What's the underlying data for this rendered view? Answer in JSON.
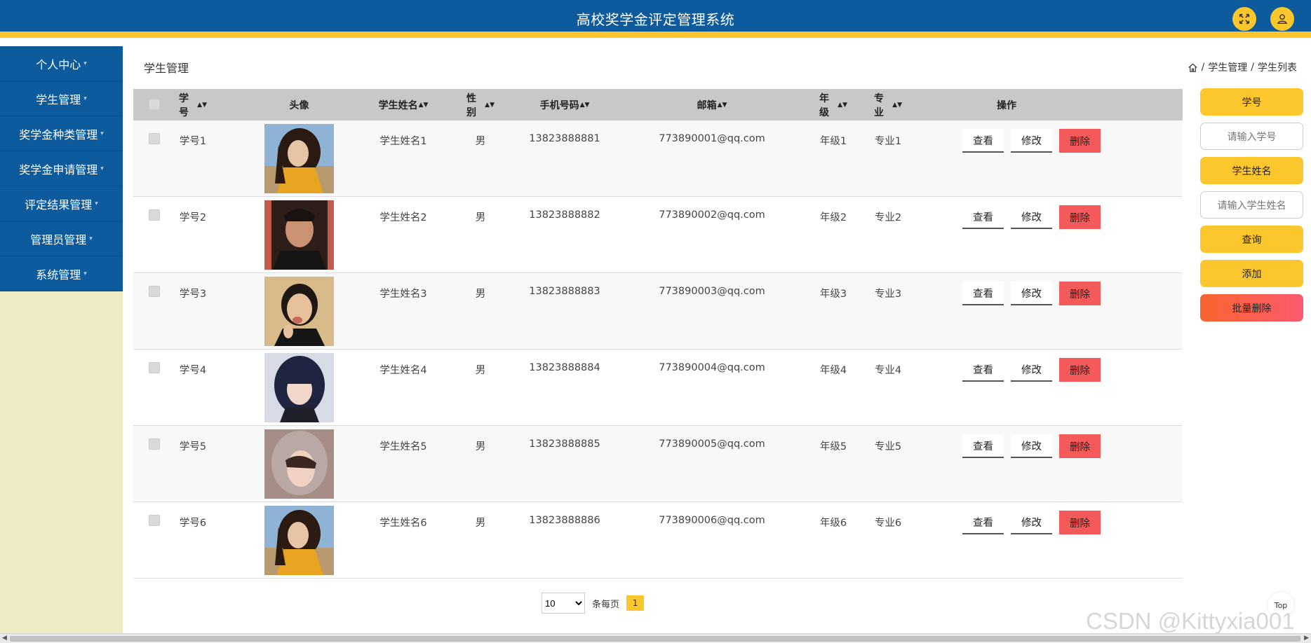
{
  "header": {
    "title": "高校奖学金评定管理系统"
  },
  "sidebar": {
    "items": [
      {
        "label": "个人中心"
      },
      {
        "label": "学生管理"
      },
      {
        "label": "奖学金种类管理"
      },
      {
        "label": "奖学金申请管理"
      },
      {
        "label": "评定结果管理"
      },
      {
        "label": "管理员管理"
      },
      {
        "label": "系统管理"
      }
    ]
  },
  "page": {
    "heading": "学生管理",
    "breadcrumb": [
      "学生管理",
      "学生列表"
    ],
    "breadcrumb_sep": "/"
  },
  "table": {
    "headers": {
      "id": "学号",
      "avatar": "头像",
      "name": "学生姓名",
      "gender": "性别",
      "phone": "手机号码",
      "email": "邮箱",
      "grade": "年级",
      "major": "专业",
      "ops": "操作"
    },
    "rows": [
      {
        "id": "学号1",
        "name": "学生姓名1",
        "gender": "男",
        "phone": "13823888881",
        "email": "773890001@qq.com",
        "grade": "年级1",
        "major": "专业1",
        "avatar": "girl-orange"
      },
      {
        "id": "学号2",
        "name": "学生姓名2",
        "gender": "男",
        "phone": "13823888882",
        "email": "773890002@qq.com",
        "grade": "年级2",
        "major": "专业2",
        "avatar": "man-dark"
      },
      {
        "id": "学号3",
        "name": "学生姓名3",
        "gender": "男",
        "phone": "13823888883",
        "email": "773890003@qq.com",
        "grade": "年级3",
        "major": "专业3",
        "avatar": "boy-hand"
      },
      {
        "id": "学号4",
        "name": "学生姓名4",
        "gender": "男",
        "phone": "13823888884",
        "email": "773890004@qq.com",
        "grade": "年级4",
        "major": "专业4",
        "avatar": "girl-dark-hair"
      },
      {
        "id": "学号5",
        "name": "学生姓名5",
        "gender": "男",
        "phone": "13823888885",
        "email": "773890005@qq.com",
        "grade": "年级5",
        "major": "专业5",
        "avatar": "hood"
      },
      {
        "id": "学号6",
        "name": "学生姓名6",
        "gender": "男",
        "phone": "13823888886",
        "email": "773890006@qq.com",
        "grade": "年级6",
        "major": "专业6",
        "avatar": "girl-orange"
      }
    ],
    "actions": {
      "view": "查看",
      "edit": "修改",
      "delete": "删除"
    }
  },
  "pagination": {
    "page_size": "10",
    "per_page_label": "条每页",
    "current_page": "1"
  },
  "search_panel": {
    "id_label": "学号",
    "id_placeholder": "请输入学号",
    "name_label": "学生姓名",
    "name_placeholder": "请输入学生姓名",
    "query_label": "查询",
    "add_label": "添加",
    "batch_delete_label": "批量删除"
  },
  "top_button": "Top",
  "watermark": "CSDN @Kittyxia001",
  "colors": {
    "primary": "#0d5a9c",
    "accent": "#fcc62d",
    "danger": "#f45a5a",
    "sidebar_bg": "#eeecc4"
  }
}
